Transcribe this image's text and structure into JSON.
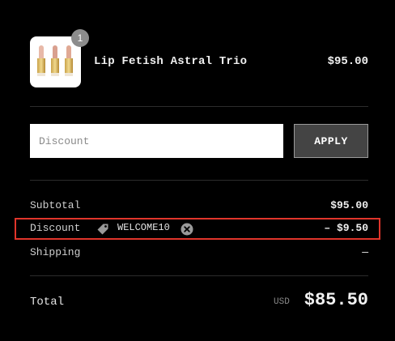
{
  "cart": {
    "item": {
      "quantity": "1",
      "name": "Lip Fetish Astral Trio",
      "price": "$95.00"
    }
  },
  "discount_form": {
    "placeholder": "Discount",
    "apply_label": "APPLY"
  },
  "summary": {
    "subtotal_label": "Subtotal",
    "subtotal_value": "$95.00",
    "discount_label": "Discount",
    "discount_code": "WELCOME10",
    "discount_value": "– $9.50",
    "shipping_label": "Shipping",
    "shipping_value": "—",
    "total_label": "Total",
    "currency": "USD",
    "total_value": "$85.50"
  },
  "icons": {
    "tag": "tag-icon",
    "remove": "close-circle-icon"
  },
  "colors": {
    "background": "#000000",
    "highlight": "#e0352b",
    "apply_button": "#444444",
    "badge": "#8c8c8c"
  }
}
